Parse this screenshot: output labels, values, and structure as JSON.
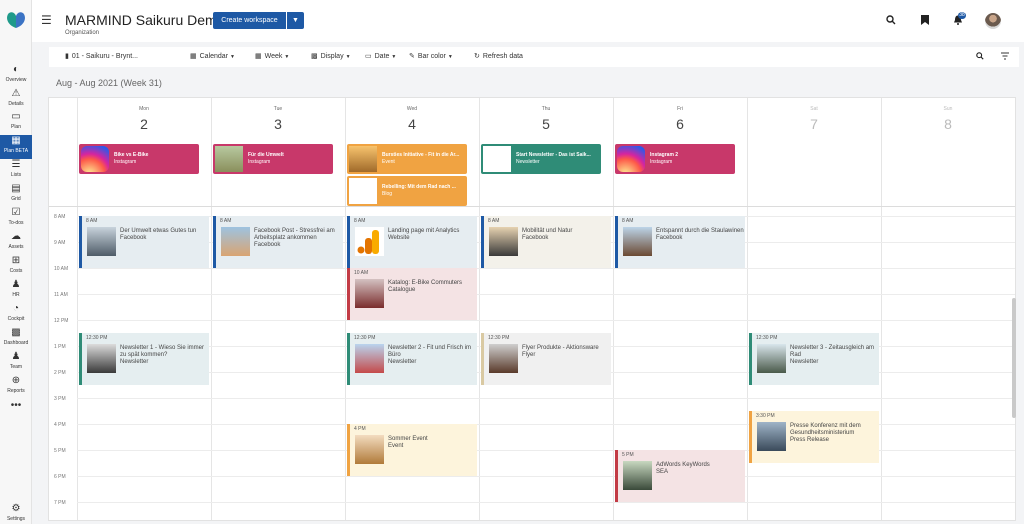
{
  "header": {
    "title": "MARMIND Saikuru Demo",
    "subtitle": "Organization",
    "create_label": "Create workspace",
    "notif_count": "38"
  },
  "nav": [
    {
      "label": "Overview",
      "icon": "overview-icon",
      "glyph": "◐"
    },
    {
      "label": "Details",
      "icon": "details-icon",
      "glyph": "⚠"
    },
    {
      "label": "Plan",
      "icon": "plan-icon",
      "glyph": "▭"
    },
    {
      "label": "Plan BETA",
      "icon": "calendar-icon",
      "glyph": "▦"
    },
    {
      "label": "Lists",
      "icon": "lists-icon",
      "glyph": "☰"
    },
    {
      "label": "Grid",
      "icon": "grid-icon",
      "glyph": "▤"
    },
    {
      "label": "To-dos",
      "icon": "todos-icon",
      "glyph": "☑"
    },
    {
      "label": "Assets",
      "icon": "assets-icon",
      "glyph": "☁"
    },
    {
      "label": "Costs",
      "icon": "costs-icon",
      "glyph": "⊞"
    },
    {
      "label": "HR",
      "icon": "hr-icon",
      "glyph": "♟"
    },
    {
      "label": "Cockpit",
      "icon": "cockpit-icon",
      "glyph": "◔"
    },
    {
      "label": "Dashboard",
      "icon": "dashboard-icon",
      "glyph": "▩"
    },
    {
      "label": "Team",
      "icon": "team-icon",
      "glyph": "♟"
    },
    {
      "label": "Reports",
      "icon": "reports-icon",
      "glyph": "⊕"
    },
    {
      "label": "",
      "icon": "more-icon",
      "glyph": "•••"
    }
  ],
  "settings_label": "Settings",
  "toolbar": {
    "workspace": "01 - Saikuru - Brynt...",
    "calendar": "Calendar",
    "week": "Week",
    "display": "Display",
    "date": "Date",
    "bar_color": "Bar color",
    "refresh": "Refresh data"
  },
  "week_title": "Aug - Aug 2021 (Week 31)",
  "days": [
    {
      "name": "Mon",
      "date": "2"
    },
    {
      "name": "Tue",
      "date": "3"
    },
    {
      "name": "Wed",
      "date": "4"
    },
    {
      "name": "Thu",
      "date": "5"
    },
    {
      "name": "Fri",
      "date": "6"
    },
    {
      "name": "Sat",
      "date": "7"
    },
    {
      "name": "Sun",
      "date": "8"
    }
  ],
  "hours": [
    "8 AM",
    "9 AM",
    "10 AM",
    "11 AM",
    "12 PM",
    "1 PM",
    "2 PM",
    "3 PM",
    "4 PM",
    "5 PM",
    "6 PM",
    "7 PM"
  ],
  "allday_events": [
    {
      "title": "Bike vs E-Bike",
      "channel": "Instagram",
      "color": "#c8386a"
    },
    {
      "title": "Für die Umwelt",
      "channel": "Instagram",
      "color": "#c8386a"
    },
    {
      "title": "Bursties Initiative - Fit in die Ar...",
      "channel": "Event",
      "color": "#f0a342"
    },
    {
      "title": "Rebelling: Mit dem Rad nach ...",
      "channel": "Blog",
      "color": "#f0a342"
    },
    {
      "title": "Start Newsletter - Das ist Saik...",
      "channel": "Newsletter",
      "color": "#2f8c77"
    },
    {
      "title": "Instagram 2",
      "channel": "Instagram",
      "color": "#c8386a"
    }
  ],
  "events": [
    {
      "time": "8 AM",
      "title": "Der Umwelt etwas Gutes tun",
      "channel": "Facebook"
    },
    {
      "time": "8 AM",
      "title": "Facebook Post - Stressfrei am Arbeitsplatz ankommen",
      "channel": "Facebook"
    },
    {
      "time": "8 AM",
      "title": "Landing page mit Analytics",
      "channel": "Website"
    },
    {
      "time": "8 AM",
      "title": "Mobilität und Natur",
      "channel": "Facebook"
    },
    {
      "time": "8 AM",
      "title": "Entspannt durch die Staulawinen",
      "channel": "Facebook"
    },
    {
      "time": "10 AM",
      "title": "Katalog: E-Bike Commuters",
      "channel": "Catalogue"
    },
    {
      "time": "12:30 PM",
      "title": "Newsletter 1 - Wieso Sie immer zu spät kommen?",
      "channel": "Newsletter"
    },
    {
      "time": "12:30 PM",
      "title": "Newsletter 2 - Fit und Frisch im Büro",
      "channel": "Newsletter"
    },
    {
      "time": "12:30 PM",
      "title": "Flyer Produkte - Aktionsware",
      "channel": "Flyer"
    },
    {
      "time": "12:30 PM",
      "title": "Newsletter 3 - Zeitausgleich am Rad",
      "channel": "Newsletter"
    },
    {
      "time": "3:30 PM",
      "title": "Presse Konferenz mit dem Gesundheitsministerium",
      "channel": "Press Release"
    },
    {
      "time": "4 PM",
      "title": "Sommer Event",
      "channel": "Event"
    },
    {
      "time": "5 PM",
      "title": "AdWords KeyWords",
      "channel": "SEA"
    }
  ]
}
